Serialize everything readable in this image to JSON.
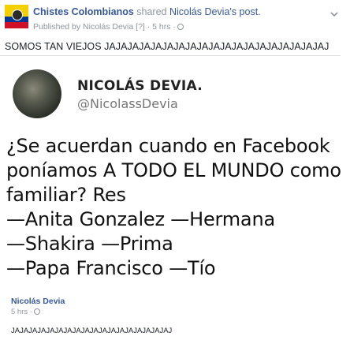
{
  "post": {
    "page_name": "Chistes Colombianos",
    "action_text": "shared",
    "original_author_possessive": "Nicolás Devia's",
    "object": "post.",
    "published_by": "Published by Nicolás Devia [?] · 5 hrs ·",
    "text": "SOMOS TAN VIEJOS JAJAJAJAJAJAJAJAJAJAJAJAJAJAJAJAJAJAJAJ"
  },
  "meme": {
    "name": "NICOLÁS DEVIA.",
    "handle": "@NicolassDevia",
    "lines": [
      "¿Se acuerdan cuando en Facebook",
      "poníamos A TODO EL MUNDO como",
      "familiar? Res",
      "—Anita Gonzalez —Hermana",
      "—Shakira —Prima",
      "—Papa Francisco —Tío"
    ]
  },
  "original_post": {
    "author": "Nicolás Devia",
    "time": "5 hrs ·",
    "text": "JAJAJAJAJAJAJAJAJAJAJAJAJAJAJAJAJAJAJ"
  },
  "icons": {
    "page_avatar": "colombia-flag-avatar",
    "privacy": "globe-icon",
    "options": "chevron-down-icon"
  }
}
